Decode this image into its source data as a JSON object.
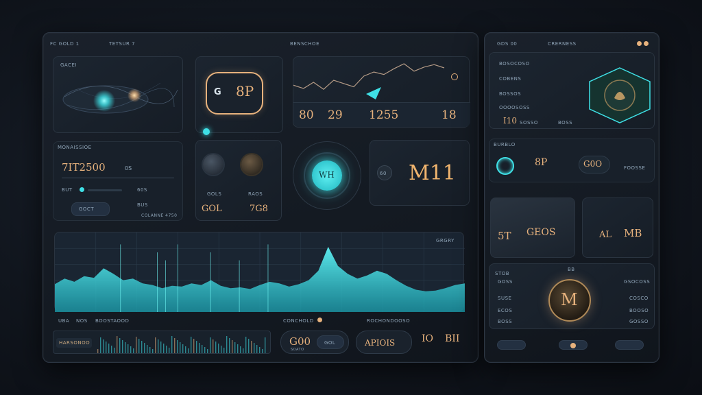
{
  "main": {
    "header": {
      "logo_text": "FC GOLD 1",
      "nav_label": "TETSUR 7",
      "center_label": "BENSCHOE"
    },
    "card_orb": {
      "label": "GACEI"
    },
    "card_badge": {
      "glyph": "G",
      "value": "8P"
    },
    "card_line": {
      "values": [
        "80",
        "29",
        "1255",
        "18"
      ]
    },
    "card_stat": {
      "label": "MONAISSIOE",
      "value": "7IT2500",
      "unit": "0S",
      "sub_left": "BUT",
      "sub_mid": "60S",
      "sub_mid2": "BUS",
      "button": "GOCT",
      "footer": "COLANNE 4750"
    },
    "card_knobs": {
      "labels": [
        "GOLS",
        "RAOS"
      ],
      "value_left": "GOL",
      "value_right": "7G8"
    },
    "card_dial": {
      "value": "WH"
    },
    "card_metric": {
      "value": "M11",
      "icon_label": "60"
    },
    "wave": {
      "label": "GRGRY"
    },
    "footer": {
      "labels": [
        "UBA",
        "NOS",
        "BOOSTAOOD",
        "CONCHOLD",
        "ROCHONDOOSO"
      ],
      "tag": "HARSONOO",
      "value_left": "G00",
      "value_left_sub": "SOATO",
      "pill": "GOL",
      "value_mid": "APIOIS",
      "value_right1": "IO",
      "value_right2": "BII"
    }
  },
  "side": {
    "header": {
      "left": "GDS 00",
      "center": "CRERNESS"
    },
    "list": [
      "BOSOCOSO",
      "COBENS",
      "BOSSOS",
      "OOOOSOSS"
    ],
    "row_value": "I10",
    "row_tags": [
      "SOSSO",
      "BOSS"
    ],
    "status": {
      "label": "BURBLO",
      "value": "8P",
      "value2": "G0O",
      "button": "FOOSSE"
    },
    "stats": {
      "left": "5T",
      "mid": "GEOS",
      "right1": "AL",
      "right2": "MB"
    },
    "coin": {
      "top_label": "BB",
      "left_label": "STOB",
      "left_rows": [
        "GOSS",
        "SUSE",
        "ECOS",
        "BOSS"
      ],
      "right_rows": [
        "GSOCOSS",
        "COSCO",
        "BOOSO",
        "GOSSO"
      ],
      "glyph": "M"
    }
  },
  "wave_chart": {
    "type": "area",
    "points": [
      0.35,
      0.42,
      0.38,
      0.45,
      0.43,
      0.55,
      0.48,
      0.4,
      0.42,
      0.36,
      0.34,
      0.3,
      0.33,
      0.32,
      0.36,
      0.34,
      0.4,
      0.33,
      0.3,
      0.31,
      0.29,
      0.34,
      0.38,
      0.36,
      0.32,
      0.35,
      0.4,
      0.52,
      0.82,
      0.58,
      0.48,
      0.42,
      0.46,
      0.52,
      0.48,
      0.4,
      0.33,
      0.28,
      0.26,
      0.27,
      0.3,
      0.34,
      0.36
    ]
  },
  "line_chart": {
    "type": "line",
    "points": [
      0.62,
      0.7,
      0.55,
      0.72,
      0.5,
      0.58,
      0.66,
      0.4,
      0.3,
      0.36,
      0.22,
      0.1,
      0.28,
      0.18,
      0.12,
      0.2
    ]
  },
  "colors": {
    "accent_cyan": "#3fe0e6",
    "accent_gold": "#e7b27d",
    "panel": "#18202a"
  }
}
